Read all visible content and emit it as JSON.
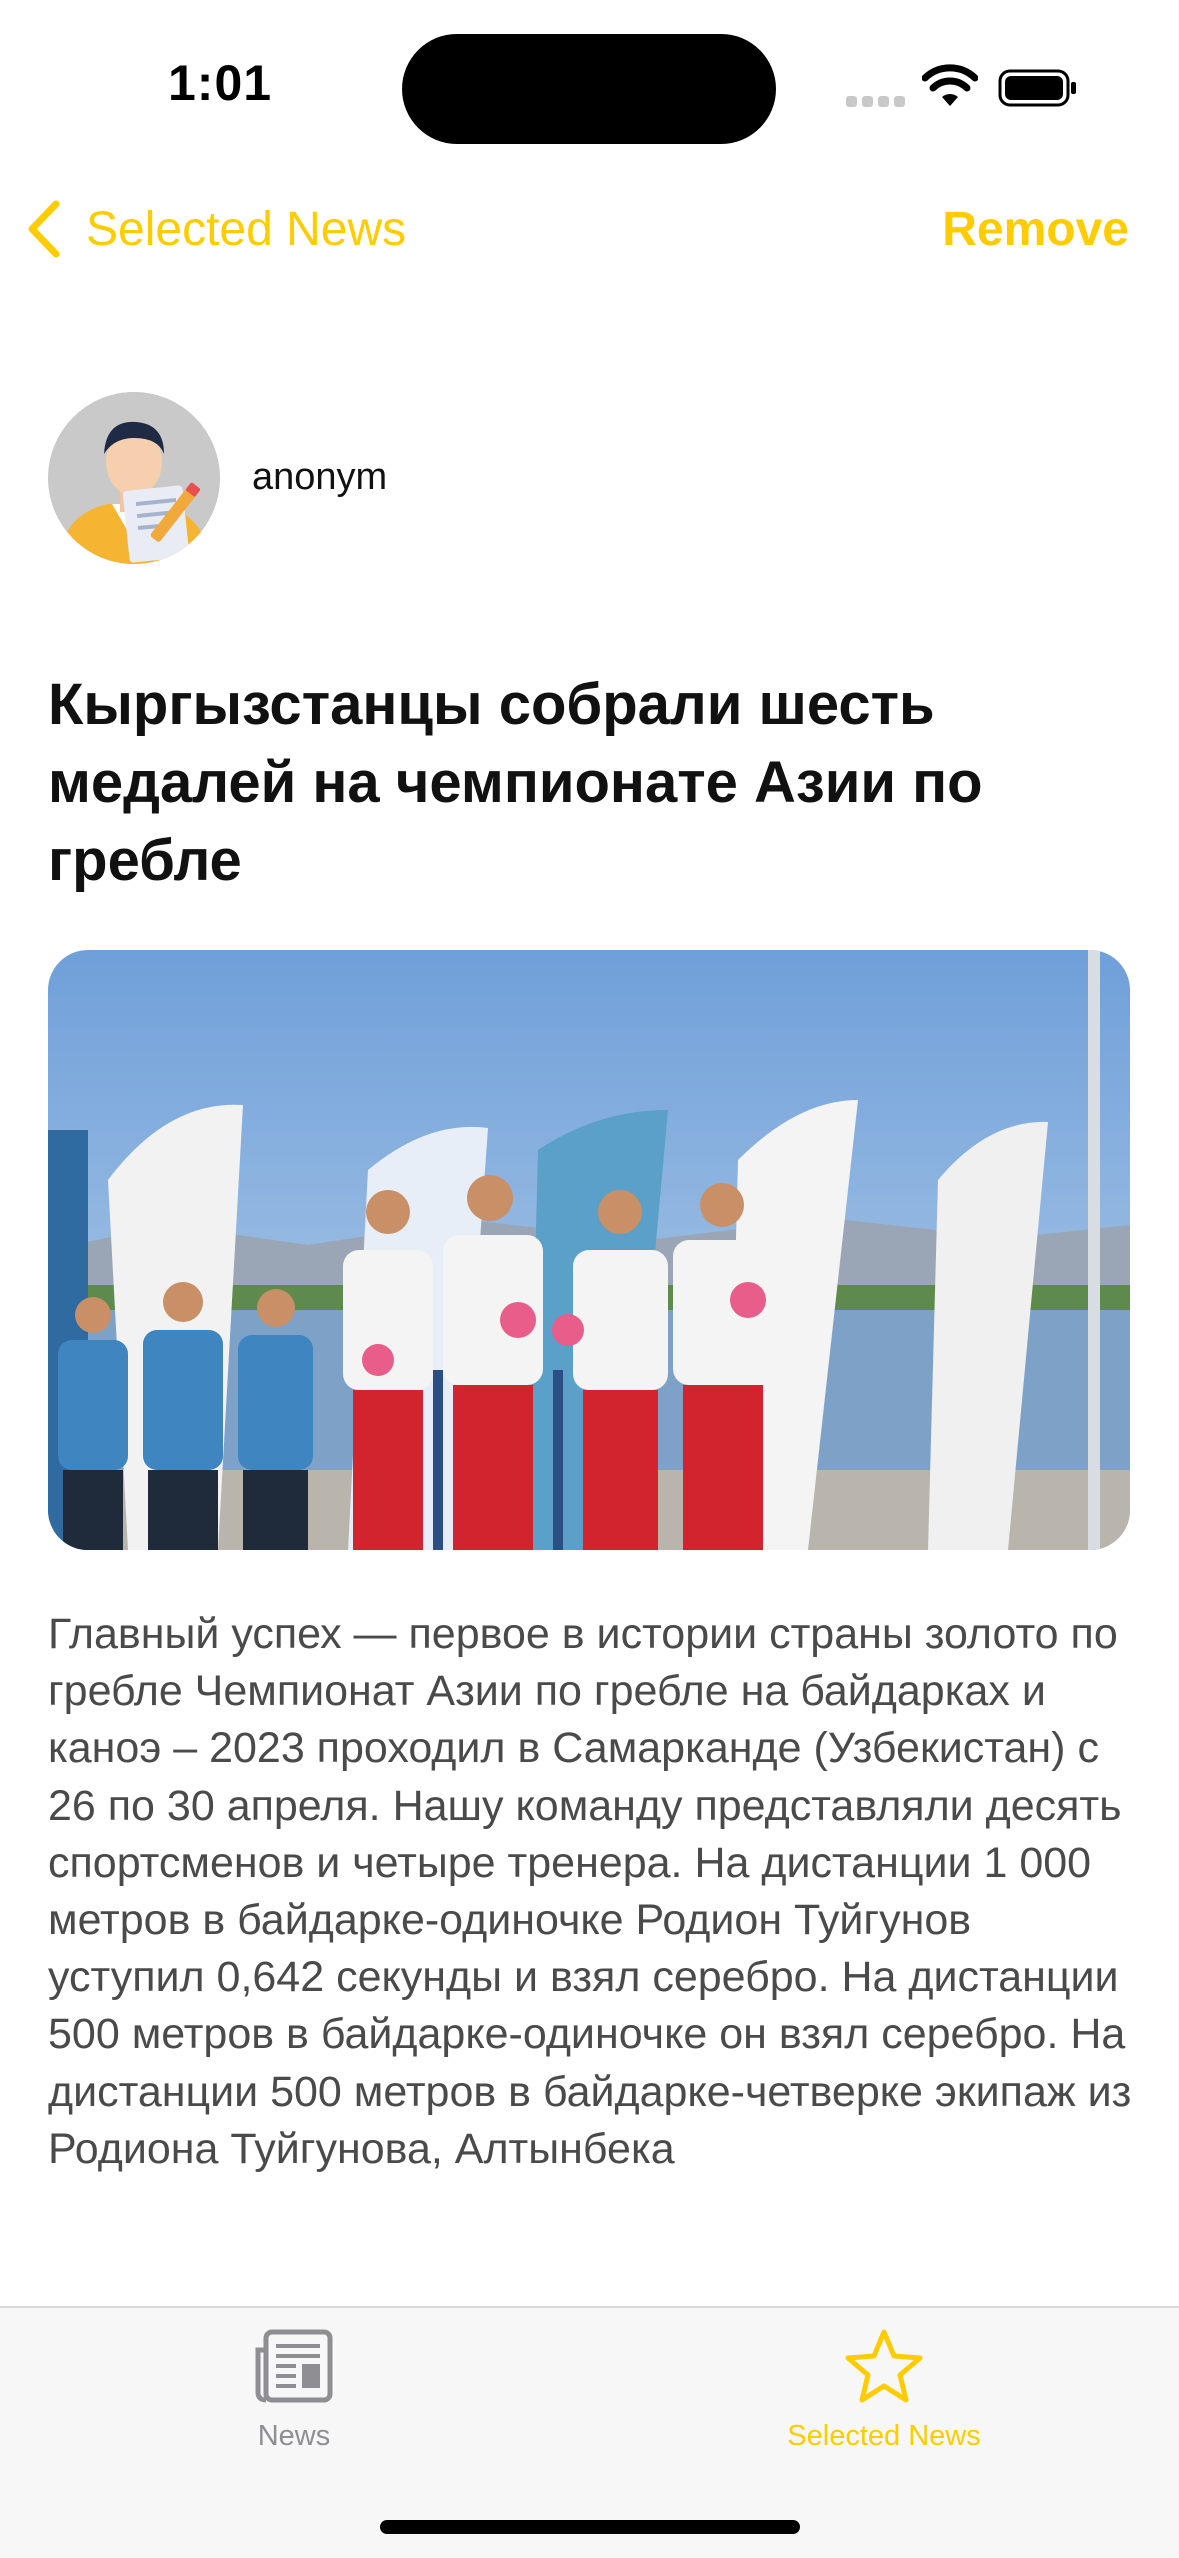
{
  "status_bar": {
    "time": "1:01"
  },
  "nav": {
    "back_label": "Selected News",
    "action_label": "Remove"
  },
  "author": {
    "name": "anonym"
  },
  "article": {
    "title": "Кыргызстанцы собрали шесть медалей на чемпионате Азии по гребле",
    "body": "Главный успех — первое в истории страны золото по гребле Чемпионат Азии по гребле на байдарках и каноэ – 2023 проходил в Самарканде (Узбекистан) с 26 по 30 апреля. Нашу команду представляли десять спортсменов и четыре тренера. На дистанции 1 000 метров в байдарке-одиночке Родион Туйгунов уступил 0,642 секунды и взял серебро. На дистанции 500 метров в байдарке-одиночке он взял серебро. На дистанции 500 метров в байдарке-четверке экипаж из Родиона Туйгунова, Алтынбека"
  },
  "tab_bar": {
    "tabs": [
      {
        "label": "News",
        "icon": "newspaper-icon",
        "active": false
      },
      {
        "label": "Selected News",
        "icon": "star-icon",
        "active": true
      }
    ]
  },
  "colors": {
    "accent": "#FFCC00",
    "inactive": "#8e8e93",
    "body_text": "#4a4a4a"
  }
}
